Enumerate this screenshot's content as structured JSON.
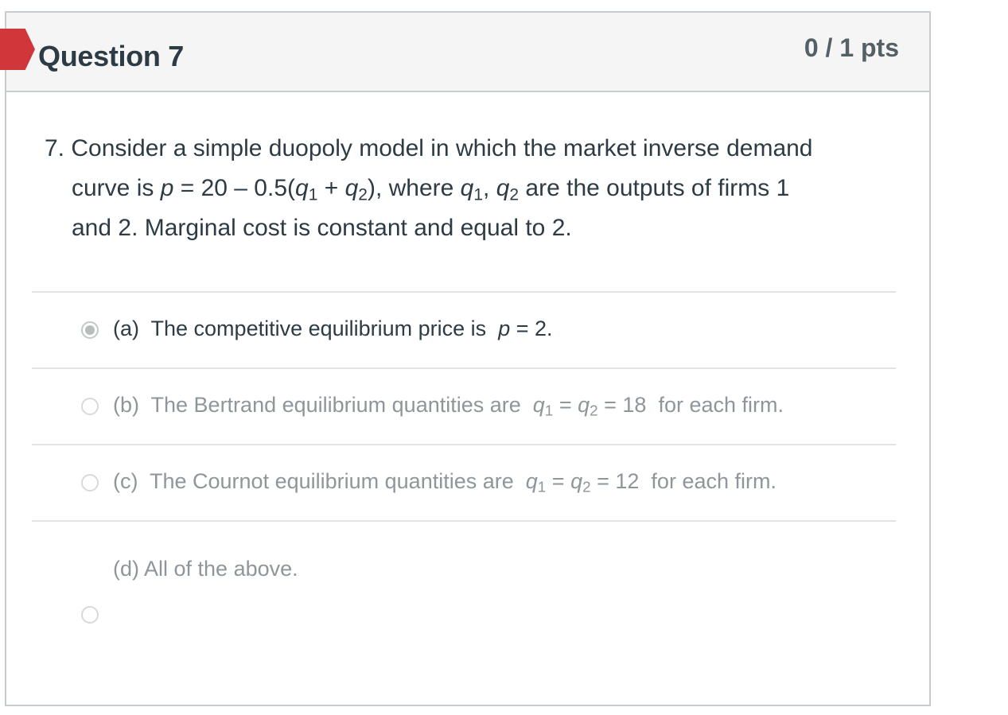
{
  "question": {
    "title": "Question 7",
    "points": "0 / 1 pts",
    "text_line1": "7. Consider a simple duopoly model in which the market inverse demand",
    "text_line2_a": "curve is ",
    "text_line2_math": "p = 20 – 0.5(q1 + q2),",
    "text_line2_b": " where ",
    "text_line2_math2": "q1, q2",
    "text_line2_c": " are the outputs of firms 1",
    "text_line3": "and 2.  Marginal cost is constant and equal to 2."
  },
  "answers": [
    {
      "label": "(a)  The competitive equilibrium price is  p = 2.",
      "selected": true
    },
    {
      "label": "(b)  The Bertrand equilibrium quantities are  q1 = q2 = 18  for each firm.",
      "selected": false
    },
    {
      "label": "(c)  The Cournot equilibrium quantities are  q1 = q2 = 12  for each firm.",
      "selected": false
    },
    {
      "label": "(d)  All of the above.",
      "selected": false
    }
  ],
  "colors": {
    "flag": "#d0373a",
    "header_bg": "#f5f5f5",
    "text": "#2d3b45",
    "muted": "#8f969b"
  }
}
